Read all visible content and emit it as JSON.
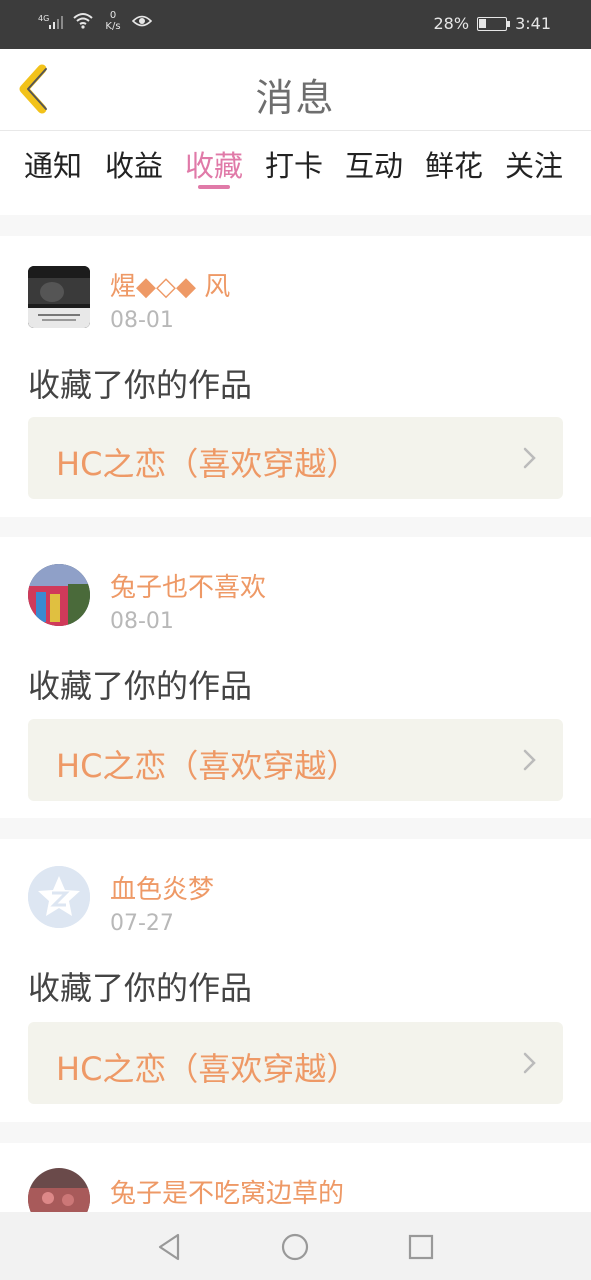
{
  "status_bar": {
    "network": "4G",
    "speed_value": "0",
    "speed_unit": "K/s",
    "battery": "28%",
    "time": "3:41"
  },
  "header": {
    "title": "消息"
  },
  "tabs": [
    {
      "label": "通知",
      "active": false
    },
    {
      "label": "收益",
      "active": false
    },
    {
      "label": "收藏",
      "active": true
    },
    {
      "label": "打卡",
      "active": false
    },
    {
      "label": "互动",
      "active": false
    },
    {
      "label": "鲜花",
      "active": false
    },
    {
      "label": "关注",
      "active": false
    }
  ],
  "messages": [
    {
      "user": "煋◆◇◆ 风",
      "date": "08-01",
      "action": "收藏了你的作品",
      "work": "HC之恋（喜欢穿越）"
    },
    {
      "user": "兔子也不喜欢",
      "date": "08-01",
      "action": "收藏了你的作品",
      "work": "HC之恋（喜欢穿越）"
    },
    {
      "user": "血色炎梦",
      "date": "07-27",
      "action": "收藏了你的作品",
      "work": "HC之恋（喜欢穿越）"
    },
    {
      "user": "兔子是不吃窝边草的"
    }
  ],
  "colors": {
    "accent": "#e07aa8",
    "username": "#ee9966",
    "status_bar": "#3c3c3c"
  }
}
